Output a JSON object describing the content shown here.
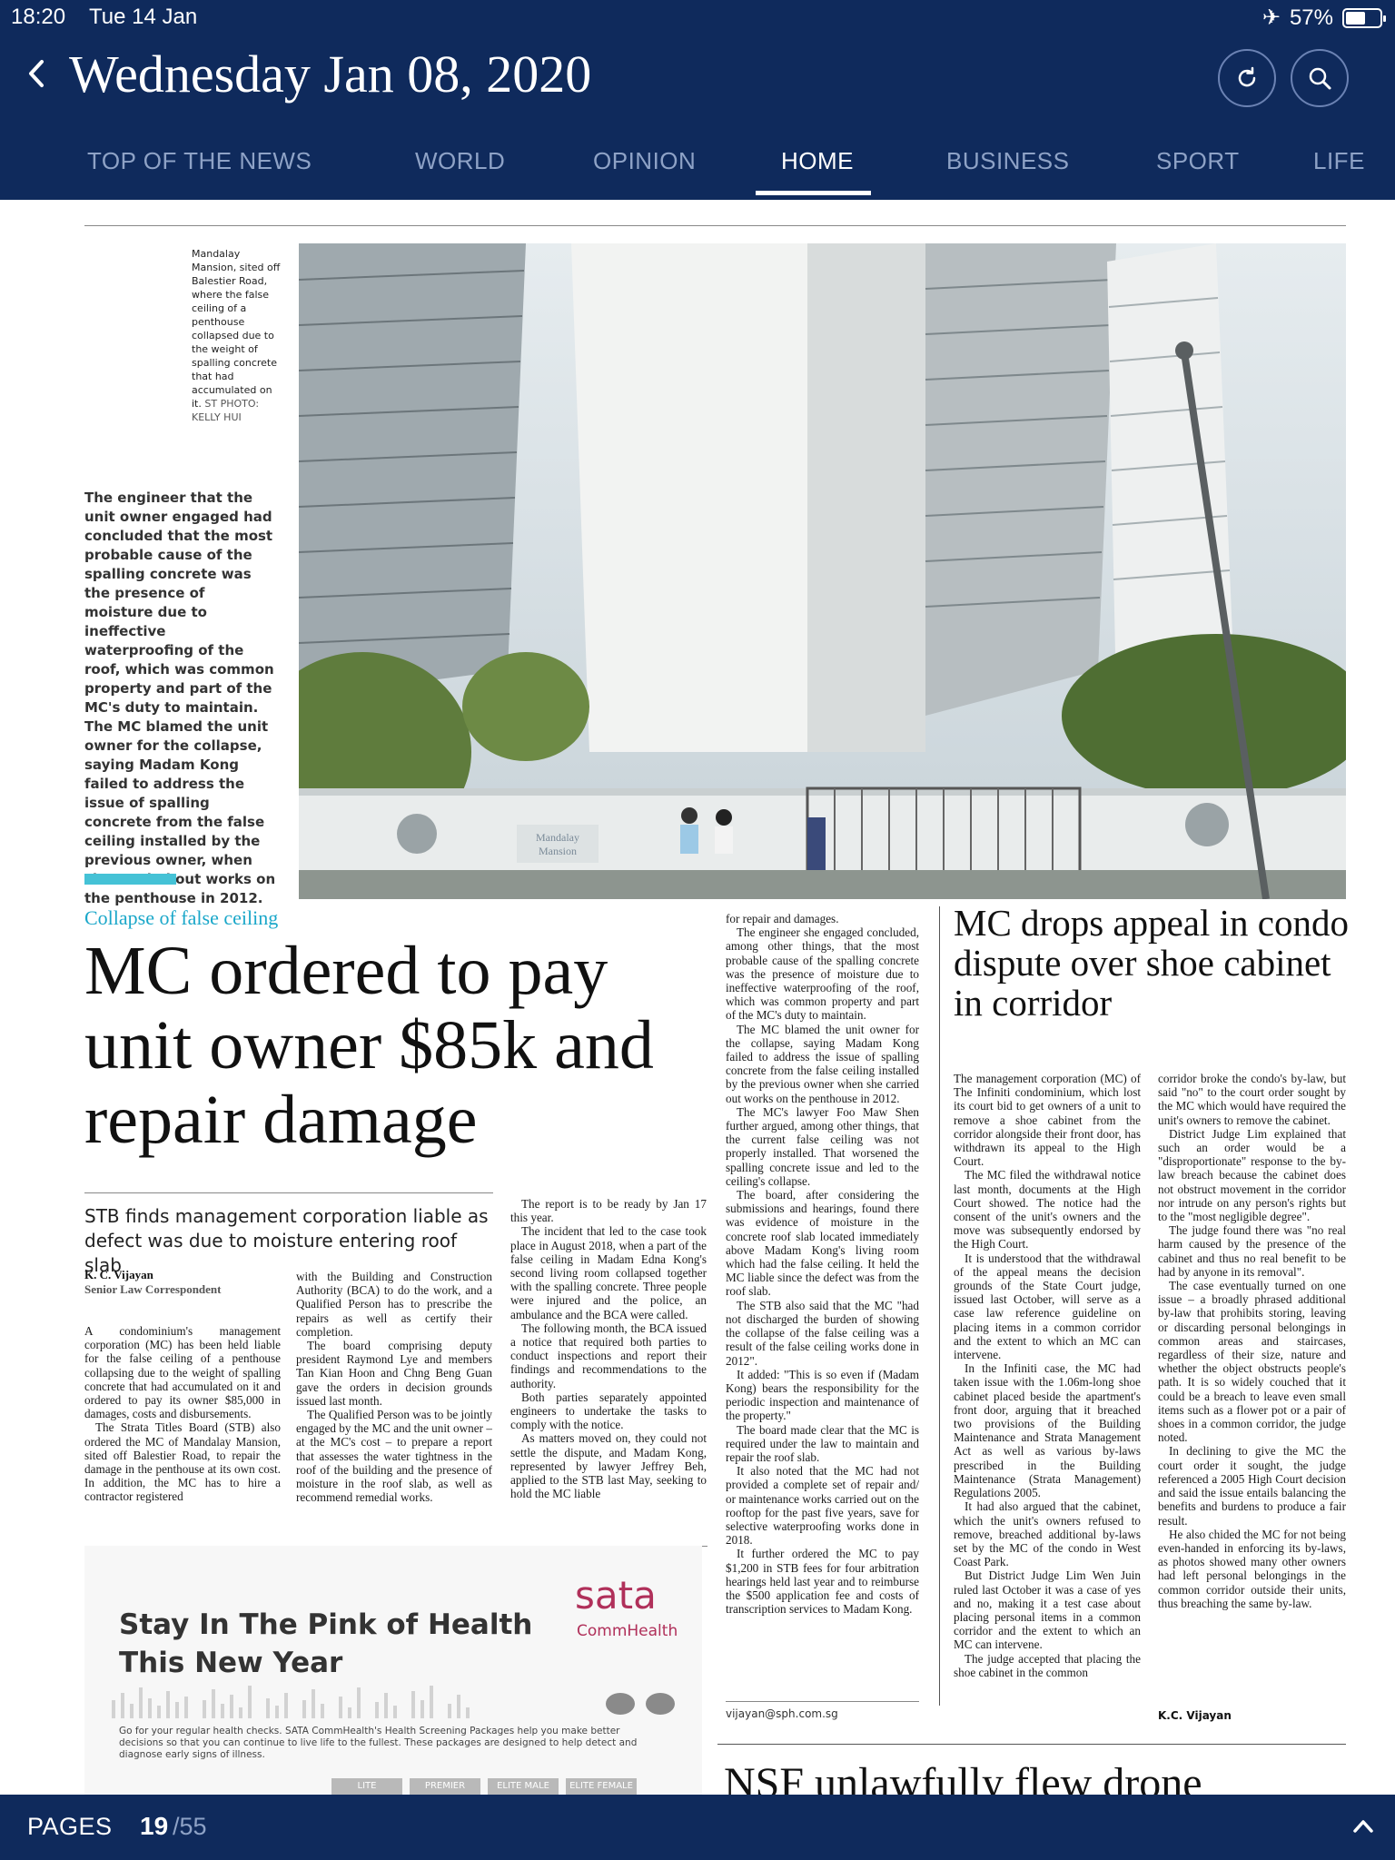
{
  "status": {
    "time": "18:20",
    "date": "Tue 14 Jan",
    "battery": "57%",
    "battery_level": 0.57
  },
  "header": {
    "issue_date": "Wednesday Jan 08, 2020"
  },
  "sections": [
    "TOP OF THE NEWS",
    "WORLD",
    "OPINION",
    "HOME",
    "BUSINESS",
    "SPORT",
    "LIFE"
  ],
  "active_section": "HOME",
  "article": {
    "photo_caption": "Mandalay Mansion, sited off Balestier Road, where the false ceiling of a penthouse collapsed due to the weight of spalling concrete that had accumulated on it.",
    "photo_credit": "ST PHOTO: KELLY HUI",
    "photo_sign": "Mandalay Mansion",
    "pullquote": "The engineer that the unit owner engaged had concluded that the most probable cause of the spalling concrete was the presence of moisture due to ineffective waterproofing of the roof, which was common property and part of the MC's duty to maintain. The MC blamed the unit owner for the collapse, saying Madam Kong failed to address the issue of spalling concrete from the false ceiling installed by the previous owner, when she carried out works on the penthouse in 2012.",
    "kicker": "Collapse of false ceiling",
    "headline": "MC ordered to pay unit owner $85k and repair damage",
    "subhead": "STB finds management corporation liable as defect was due to moisture entering roof slab",
    "byline_name": "K. C. Vijayan",
    "byline_role": "Senior Law Correspondent",
    "col1": [
      "A condominium's management corporation (MC) has been held liable for the false ceiling of a penthouse collapsing due to the weight of spalling concrete that had accumulated on it and ordered to pay its owner $85,000 in damages, costs and disbursements.",
      "The Strata Titles Board (STB) also ordered the MC of Mandalay Mansion, sited off Balestier Road, to repair the damage in the penthouse at its own cost. In addition, the MC has to hire a contractor registered"
    ],
    "col2": [
      "with the Building and Construction Authority (BCA) to do the work, and a Qualified Person has to prescribe the repairs as well as certify their completion.",
      "The board comprising deputy president Raymond Lye and members Tan Kian Hoon and Chng Beng Guan gave the orders in decision grounds issued last month.",
      "The Qualified Person was to be jointly engaged by the MC and the unit owner – at the MC's cost – to prepare a report that assesses the water tightness in the roof of the building and the presence of moisture in the roof slab, as well as recommend remedial works."
    ],
    "col3": [
      "The report is to be ready by Jan 17 this year.",
      "The incident that led to the case took place in August 2018, when a part of the false ceiling in Madam Edna Kong's second living room collapsed together with the spalling concrete. Three people were injured and the police, an ambulance and the BCA were called.",
      "The following month, the BCA issued a notice that required both parties to conduct inspections and report their findings and recommendations to the authority.",
      "Both parties separately appointed engineers to undertake the tasks to comply with the notice.",
      "As matters moved on, they could not settle the dispute, and Madam Kong, represented by lawyer Jeffrey Beh, applied to the STB last May, seeking to hold the MC liable"
    ],
    "col4": [
      "for repair and damages.",
      "The engineer she engaged concluded, among other things, that the most probable cause of the spalling concrete was the presence of moisture due to ineffective waterproofing of the roof, which was common property and part of the MC's duty to maintain.",
      "The MC blamed the unit owner for the collapse, saying Madam Kong failed to address the issue of spalling concrete from the false ceiling installed by the previous owner when she carried out works on the penthouse in 2012.",
      "The MC's lawyer Foo Maw Shen further argued, among other things, that the current false ceiling was not properly installed. That worsened the spalling concrete issue and led to the ceiling's collapse.",
      "The board, after considering the submissions and hearings, found there was evidence of moisture in the concrete roof slab located immediately above Madam Kong's living room which had the false ceiling. It held the MC liable since the defect was from the roof slab.",
      "The STB also said that the MC \"had not discharged the burden of showing the collapse of the false ceiling was a result of the false ceiling works done in 2012\".",
      "It added: \"This is so even if (Madam Kong) bears the responsibility for the periodic inspection and maintenance of the property.\"",
      "The board made clear that the MC is required under the law to maintain and repair the roof slab.",
      "It also noted that the MC had not provided a complete set of repair and/ or maintenance works carried out on the rooftop for the past five years, save for selective waterproofing works done in 2018.",
      "It further ordered the MC to pay $1,200 in STB fees for four arbitration hearings held last year and to reimburse the $500 application fee and costs of transcription services to Madam Kong."
    ],
    "email": "vijayan@sph.com.sg"
  },
  "side_article": {
    "headline": "MC drops appeal in condo dispute over shoe cabinet in corridor",
    "col1": [
      "The management corporation (MC) of The Infiniti condominium, which lost its court bid to get owners of a unit to remove a shoe cabinet from the corridor alongside their front door, has withdrawn its appeal to the High Court.",
      "The MC filed the withdrawal notice last month, documents at the High Court showed. The notice had the consent of the unit's owners and the move was subsequently endorsed by the High Court.",
      "It is understood that the withdrawal of the appeal means the decision grounds of the State Court judge, issued last October, will serve as a case law reference guideline on placing items in a common corridor and the extent to which an MC can intervene.",
      "In the Infiniti case, the MC had taken issue with the 1.06m-long shoe cabinet placed beside the apartment's front door, arguing that it breached two provisions of the Building Maintenance and Strata Management Act as well as various by-laws prescribed in the Building Maintenance (Strata Management) Regulations 2005.",
      "It had also argued that the cabinet, which the unit's owners refused to remove, breached additional by-laws set by the MC of the condo in West Coast Park.",
      "But District Judge Lim Wen Juin ruled last October it was a case of yes and no, making it a test case about placing personal items in a common corridor and the extent to which an MC can intervene.",
      "The judge accepted that placing the shoe cabinet in the common"
    ],
    "col2": [
      "corridor broke the condo's by-law, but said \"no\" to the court order sought by the MC which would have required the unit's owners to remove the cabinet.",
      "District Judge Lim explained that such an order would be a \"disproportionate\" response to the by-law breach because the cabinet does not obstruct movement in the corridor nor intrude on any person's rights but to the \"most negligible degree\".",
      "The judge found there was \"no real harm caused by the presence of the cabinet and thus no real benefit to be had by anyone in its removal\".",
      "The case eventually turned on one issue – a broadly phrased additional by-law that prohibits storing, leaving or discarding personal belongings in common areas and staircases, regardless of their size, nature and whether the object obstructs people's path. It is so widely couched that it could be a breach to leave even small items such as a flower pot or a pair of shoes in a common corridor, the judge noted.",
      "In declining to give the MC the court order it sought, the judge referenced a 2005 High Court decision and said the issue entails balancing the benefits and burdens to produce a fair result.",
      "He also chided the MC for not being even-handed in enforcing its by-laws, as photos showed many other owners had left personal belongings in the common corridor outside their units, thus breaching the same by-law."
    ],
    "signoff": "K.C. Vijayan"
  },
  "ad": {
    "headline": "Stay In The Pink of Health This New Year",
    "brand": "sata",
    "brand_sub": "CommHealth",
    "text": "Go for your regular health checks. SATA CommHealth's Health Screening Packages help you make better decisions so that you can continue to live life to the fullest. These packages are designed to help detect and diagnose early signs of illness.",
    "tabs": [
      "LITE",
      "PREMIER",
      "ELITE MALE",
      "ELITE FEMALE"
    ]
  },
  "next_article": {
    "headline": "NSF unlawfully flew drone"
  },
  "footer": {
    "pages_label": "PAGES",
    "current_page": "19",
    "total_pages": "/55"
  },
  "colors": {
    "navy": "#0f2a5c",
    "tab_inactive": "#8ea2c6",
    "accent_cyan": "#1aa7c9",
    "ad_pink": "#b0305a"
  }
}
